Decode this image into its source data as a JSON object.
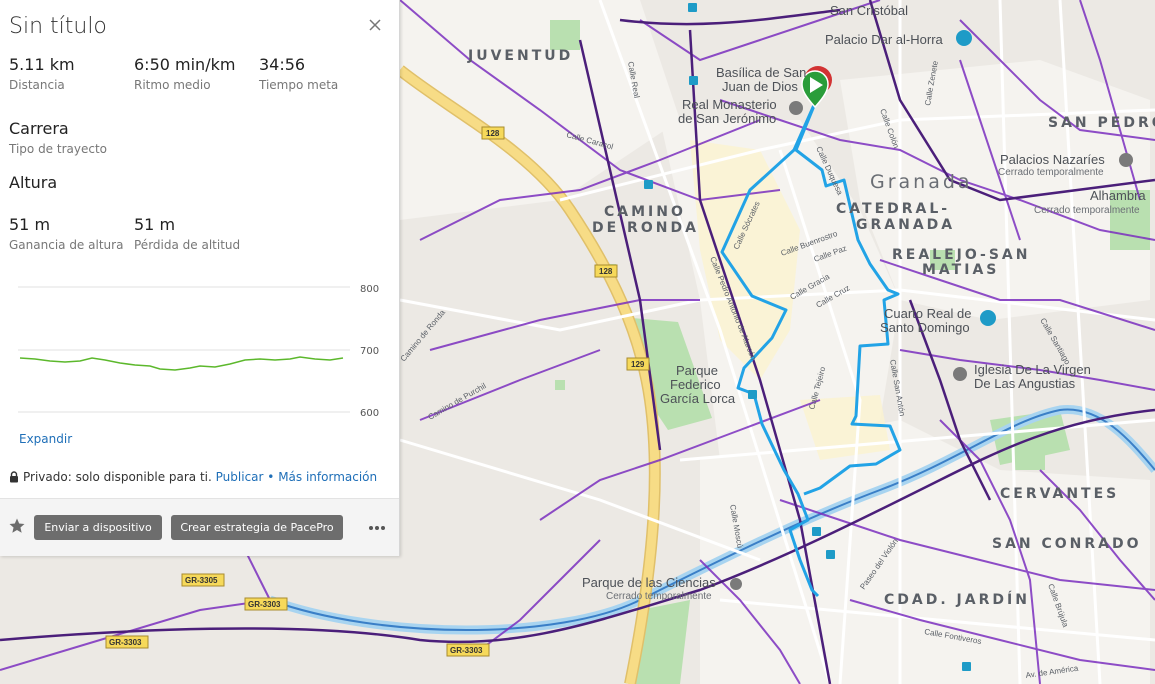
{
  "panel": {
    "title": "Sin título",
    "stats": [
      {
        "value": "5.11 km",
        "label": "Distancia"
      },
      {
        "value": "6:50 min/km",
        "label": "Ritmo medio"
      },
      {
        "value": "34:56",
        "label": "Tiempo meta"
      }
    ],
    "course_type": {
      "value": "Carrera",
      "label": "Tipo de trayecto"
    },
    "elevation_heading": "Altura",
    "elevation_stats": [
      {
        "value": "51 m",
        "label": "Ganancia de altura"
      },
      {
        "value": "51 m",
        "label": "Pérdida de altitud"
      }
    ],
    "elevation_axis": [
      "800",
      "700",
      "600"
    ],
    "expand_label": "Expandir",
    "privacy_text": "Privado: solo disponible para ti.",
    "publish_label": "Publicar",
    "separator": "•",
    "more_info_label": "Más información",
    "send_button": "Enviar a dispositivo",
    "pacepro_button": "Crear estrategia de PacePro"
  },
  "map": {
    "districts": [
      "JUVENTUD",
      "CAMINO",
      "DE RONDA",
      "CATEDRAL-",
      "GRANADA",
      "REALEJO-SAN",
      "MATIAS",
      "SAN PEDRO",
      "CERVANTES",
      "SAN CONRADO",
      "CDAD. JARDÍN"
    ],
    "city_label": "Granada",
    "pois": [
      {
        "name": "Palacio Dar al-Horra"
      },
      {
        "name": "Basílica de San"
      },
      {
        "name": "Juan de Dios"
      },
      {
        "name": "Real Monasterio"
      },
      {
        "name": "de San Jerónimo"
      },
      {
        "name": "Palacios Nazaríes",
        "note": "Cerrado temporalmente"
      },
      {
        "name": "Alhambra",
        "note": "Cerrado temporalmente"
      },
      {
        "name": "Cuarto Real de"
      },
      {
        "name": "Santo Domingo"
      },
      {
        "name": "Iglesia De La Virgen"
      },
      {
        "name": "De Las Angustias"
      },
      {
        "name": "Parque"
      },
      {
        "name": "Federico"
      },
      {
        "name": "García Lorca"
      },
      {
        "name": "Parque de las Ciencias",
        "note": "Cerrado temporalmente"
      },
      {
        "name": "San Cristóbal"
      }
    ],
    "roads": [
      "128",
      "128",
      "129",
      "GR-3305",
      "GR-3303",
      "GR-3303",
      "GR-3303"
    ],
    "streets": [
      "Calle Sócrates",
      "Calle Pedro Antonio de Alarcón",
      "Calle Gracia",
      "Calle Paz",
      "Calle Cruz",
      "Calle Tejeiro",
      "Calle San Antón",
      "Calle Buenrostro",
      "Calle Duquesa",
      "Calle Fontiveros",
      "Camino de Purchil",
      "Camino de Ronda",
      "Paseo del Violón",
      "Calle Santiago",
      "Calle Colón",
      "Calle Zenete",
      "Calle Moscú",
      "Calle Brújula",
      "Av. de América",
      "Calle Caracol",
      "Calle Real"
    ],
    "colors": {
      "route": "#22a3e6",
      "cycle": "#7b2fbf",
      "cycle_dark": "#4b1f7a",
      "highway": "#f5d77a",
      "water": "#a8d4f0",
      "park": "#b9e0b0"
    }
  }
}
